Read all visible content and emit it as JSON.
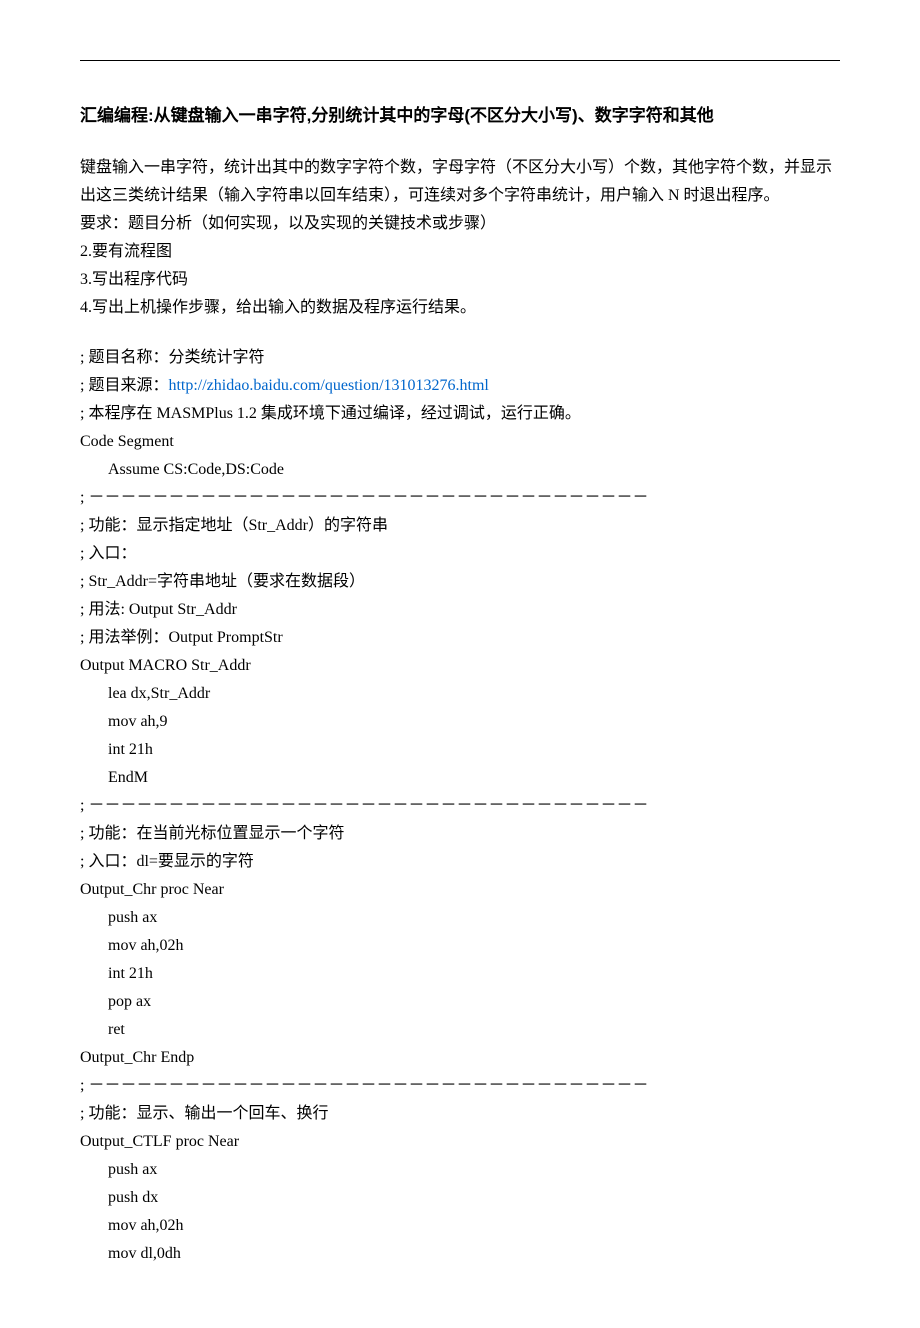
{
  "title": "汇编编程:从键盘输入一串字符,分别统计其中的字母(不区分大小写)、数字字符和其他",
  "intro": {
    "p1": "键盘输入一串字符，统计出其中的数字字符个数，字母字符（不区分大小写）个数，其他字符个数，并显示出这三类统计结果（输入字符串以回车结束），可连续对多个字符串统计，用户输入 N 时退出程序。",
    "req": "要求：题目分析（如何实现，以及实现的关键技术或步骤）",
    "r2": "2.要有流程图",
    "r3": "3.写出程序代码",
    "r4": "4.写出上机操作步骤，给出输入的数据及程序运行结果。"
  },
  "code": {
    "l1": "; 题目名称：分类统计字符",
    "l2a": "; 题目来源：",
    "l2b": "http://zhidao.baidu.com/question/131013276.html",
    "l3": "; 本程序在 MASMPlus 1.2 集成环境下通过编译，经过调试，运行正确。",
    "l4": "Code      Segment",
    "l5": "Assume    CS:Code,DS:Code",
    "l6": "; －－－－－－－－－－－－－－－－－－－－－－－－－－－－－－－－－－－",
    "l7": "; 功能：显示指定地址（Str_Addr）的字符串",
    "l8": "; 入口：",
    "l9": "; Str_Addr=字符串地址（要求在数据段）",
    "l10": "; 用法: Output Str_Addr",
    "l11": "; 用法举例：Output PromptStr",
    "l12": "Output    MACRO Str_Addr",
    "l13": "lea    dx,Str_Addr",
    "l14": "mov    ah,9",
    "l15": "int    21h",
    "l16": "EndM",
    "l17": "; －－－－－－－－－－－－－－－－－－－－－－－－－－－－－－－－－－－",
    "l18": "; 功能：在当前光标位置显示一个字符",
    "l19": "; 入口：dl=要显示的字符",
    "l20": "Output_Chr    proc    Near",
    "l21": "push    ax",
    "l22": "mov      ah,02h",
    "l23": "int       21h",
    "l24": "pop      ax",
    "l25": "ret",
    "l26": "Output_Chr    Endp",
    "l27": "; －－－－－－－－－－－－－－－－－－－－－－－－－－－－－－－－－－－",
    "l28": "; 功能：显示、输出一个回车、换行",
    "l29": "Output_CTLF proc    Near",
    "l30": "push    ax",
    "l31": "push    dx",
    "l32": "mov      ah,02h",
    "l33": "mov      dl,0dh"
  }
}
